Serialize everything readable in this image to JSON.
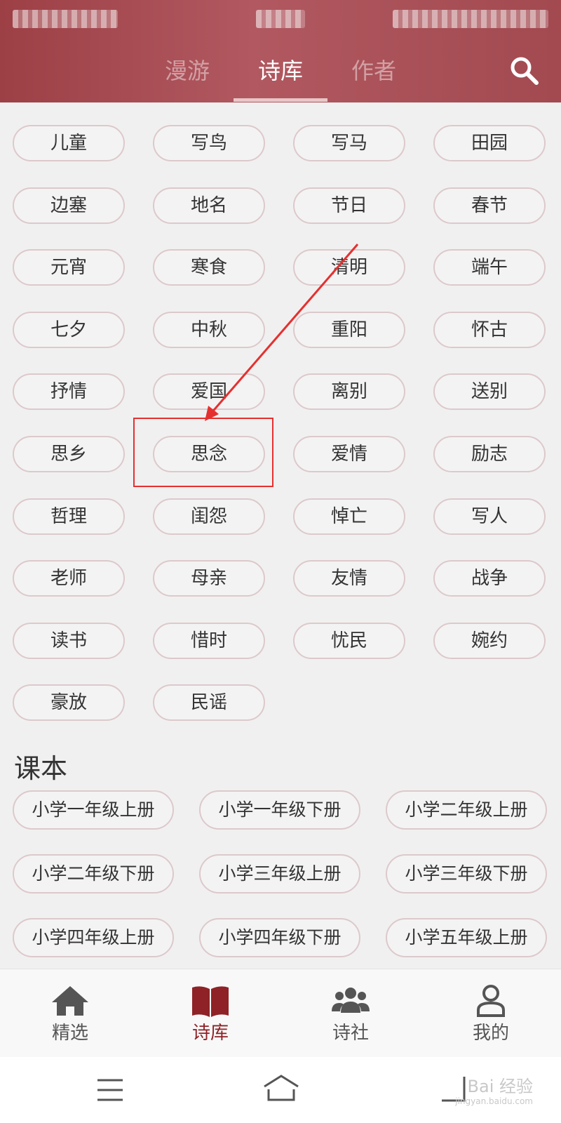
{
  "header": {
    "tabs": [
      "漫游",
      "诗库",
      "作者"
    ],
    "active_tab": "诗库"
  },
  "tags": [
    "儿童",
    "写鸟",
    "写马",
    "田园",
    "边塞",
    "地名",
    "节日",
    "春节",
    "元宵",
    "寒食",
    "清明",
    "端午",
    "七夕",
    "中秋",
    "重阳",
    "怀古",
    "抒情",
    "爱国",
    "离别",
    "送别",
    "思乡",
    "思念",
    "爱情",
    "励志",
    "哲理",
    "闺怨",
    "悼亡",
    "写人",
    "老师",
    "母亲",
    "友情",
    "战争",
    "读书",
    "惜时",
    "忧民",
    "婉约",
    "豪放",
    "民谣"
  ],
  "textbook": {
    "title": "课本",
    "items": [
      "小学一年级上册",
      "小学一年级下册",
      "小学二年级上册",
      "小学二年级下册",
      "小学三年级上册",
      "小学三年级下册",
      "小学四年级上册",
      "小学四年级下册",
      "小学五年级上册"
    ]
  },
  "bottom_nav": [
    "精选",
    "诗库",
    "诗社",
    "我的"
  ],
  "active_nav": "诗库",
  "watermark": {
    "main": "Bai 经验",
    "sub": "jingyan.baidu.com"
  },
  "colors": {
    "header": "#a84a52",
    "accent": "#8e2226",
    "annotation": "#e53030"
  }
}
